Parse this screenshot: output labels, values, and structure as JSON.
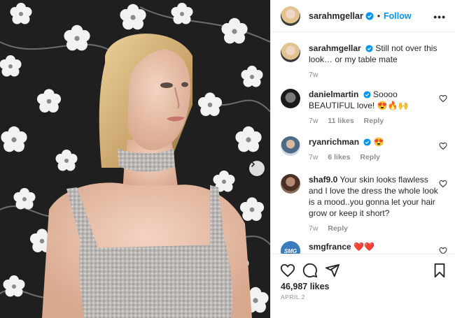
{
  "post": {
    "author": "sarahmgellar",
    "follow_label": "Follow",
    "more_label": "•••",
    "dot": "•"
  },
  "comments": [
    {
      "user": "sarahmgellar",
      "text": "Still not over this look… or my table mate",
      "time": "7w"
    },
    {
      "user": "danielmartin",
      "text": "Soooo BEAUTIFUL love! 😍🔥🙌",
      "time": "7w",
      "likes": "11 likes",
      "reply": "Reply"
    },
    {
      "user": "ryanrichman",
      "text": "😍",
      "time": "7w",
      "likes": "6 likes",
      "reply": "Reply"
    },
    {
      "user": "shaf9.0",
      "text": "Your skin looks flawless and I love the dress the whole look is a mood..you gonna let your hair grow or keep it short?",
      "time": "7w",
      "reply": "Reply"
    },
    {
      "user": "smgfrance",
      "text": "❤️❤️",
      "avatar_text": "SMG"
    }
  ],
  "footer": {
    "likes": "46,987 likes",
    "date": "APRIL 2"
  },
  "icons": {
    "verified": "verified-badge-icon",
    "heart": "heart-icon",
    "comment": "comment-icon",
    "share": "share-icon",
    "save": "bookmark-icon",
    "next": "chevron-right-icon"
  },
  "colors": {
    "accent": "#0095f6",
    "muted": "#8e8e8e",
    "text": "#262626"
  }
}
